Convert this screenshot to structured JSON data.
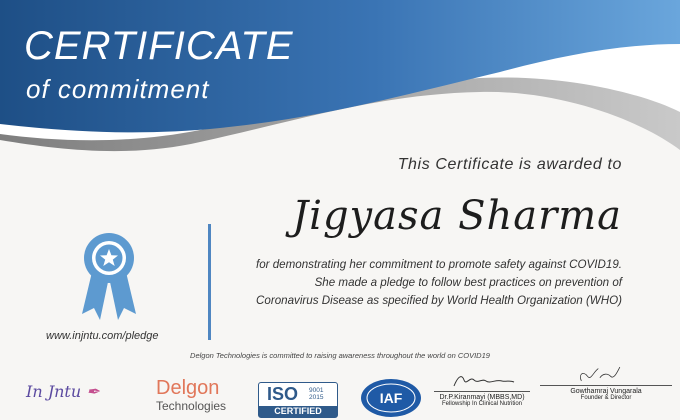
{
  "certificate": {
    "title": "CERTIFICATE",
    "subtitle": "of commitment",
    "awarded_line": "This Certificate is awarded to",
    "recipient": "Jigyasa Sharma",
    "description": [
      "for demonstrating her commitment to promote safety against COVID19.",
      "She made a pledge to follow best practices on prevention of",
      "Coronavirus Disease as specified by World Health Organization (WHO)"
    ],
    "url": "www.injntu.com/pledge",
    "footnote": "Delgon Technologies is committed to raising awareness throughout the world on COVID19"
  },
  "logos": {
    "injntu": "In Jntu",
    "delgon_name": "Delgon",
    "delgon_sub": "Technologies",
    "iso_word": "ISO",
    "iso_number": "9001",
    "iso_year": "2015",
    "iso_certified": "CERTIFIED",
    "iaf": "IAF"
  },
  "signatures": [
    {
      "name": "Dr.P.Kiranmayi (MBBS,MD)",
      "role": "Fellowship In Clinical Nutrition"
    },
    {
      "name": "Gowthamraj Vungarala",
      "role": "Founder & Director"
    }
  ],
  "colors": {
    "header_dark": "#1e4f86",
    "header_light": "#6aa6dc",
    "accent_line": "#4f86c1",
    "ribbon": "#5d9ad0"
  },
  "icons": {
    "badge": "award-ribbon-star-icon",
    "iaf": "iaf-globe-seal"
  }
}
